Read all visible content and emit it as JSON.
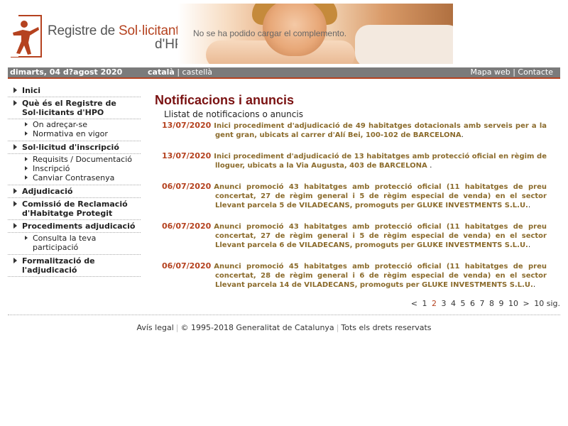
{
  "header": {
    "logo_title_part1": "Registre de ",
    "logo_title_part2": "Sol·licitants",
    "logo_subtitle": "d'HPO",
    "plugin_message": "No se ha podido cargar el complemento.",
    "accent_color": "#b5421f"
  },
  "topbar": {
    "date": "dimarts, 04 d?agost 2020",
    "lang_active": "català",
    "lang_separator": "|",
    "lang_other": "castellà",
    "link_sitemap": "Mapa web",
    "link_separator": "|",
    "link_contact": "Contacte",
    "bar_color": "#7b7b7b"
  },
  "nav": {
    "inici": "Inici",
    "que_es": "Què és el Registre de Sol·licitants d'HPO",
    "on_adrecar": "On adreçar-se",
    "normativa": "Normativa en vigor",
    "solicitud": "Sol·licitud d'inscripció",
    "requisits": "Requisits / Documentació",
    "inscripcio": "Inscripció",
    "canviar": "Canviar Contrasenya",
    "adjudicacio": "Adjudicació",
    "comissio": "Comissió de Reclamació d'Habitatge Protegit",
    "procediments": "Procediments adjudicació",
    "consulta": "Consulta la teva participació",
    "formalitzacio": "Formalització de l'adjudicació"
  },
  "main": {
    "title": "Notificacions i anuncis",
    "subtitle": "Llistat de notificacions o anuncis",
    "notices": [
      {
        "date": "13/07/2020",
        "text": "Inici procediment d'adjudicació de 49 habitatges dotacionals amb serveis per a la gent gran, ubicats al carrer d'Alí Bei, 100-102 de BARCELONA",
        "suffix": "."
      },
      {
        "date": "13/07/2020",
        "text": "Inici procediment d'adjudicació de 13 habitatges amb protecció oficial en règim de lloguer, ubicats a la Via Augusta, 403 de BARCELONA",
        "suffix": " ."
      },
      {
        "date": "06/07/2020",
        "text": "Anunci promoció 43 habitatges amb protecció oficial (11 habitatges de preu concertat, 27 de règim general i 5 de règim especial de venda) en el sector Llevant parcela 5 de VILADECANS, promoguts per GLUKE INVESTMENTS S.L.U.",
        "suffix": "."
      },
      {
        "date": "06/07/2020",
        "text": "Anunci promoció 43 habitatges amb protecció oficial (11 habitatges de preu concertat, 27 de règim general i 5 de règim especial de venda) en el sector Llevant parcela 6 de VILADECANS, promoguts per GLUKE INVESTMENTS S.L.U.",
        "suffix": "."
      },
      {
        "date": "06/07/2020",
        "text": "Anunci promoció 45 habitatges amb protecció oficial (11 habitatges de preu concertat, 28 de règim general i 6 de règim especial de venda) en el sector Llevant parcela 14 de VILADECANS, promoguts per GLUKE INVESTMENTS S.L.U.",
        "suffix": "."
      }
    ],
    "date_color": "#b5421f",
    "title_color": "#7a1212"
  },
  "pager": {
    "prev": "<",
    "pages": [
      "1",
      "2",
      "3",
      "4",
      "5",
      "6",
      "7",
      "8",
      "9",
      "10"
    ],
    "current": "2",
    "next": ">",
    "next10": "10 sig."
  },
  "footer": {
    "legal": "Avís legal",
    "copyright": "© 1995-2018 Generalitat de Catalunya",
    "rights": "Tots els drets reservats"
  }
}
